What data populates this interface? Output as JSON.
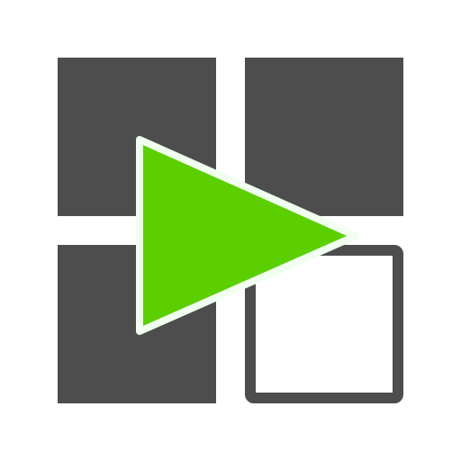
{
  "icon": {
    "name": "grid-play-icon",
    "colors": {
      "tile": "#4d4d4d",
      "empty_tile_fill": "#ffffff",
      "play": "#5ccf00",
      "play_outline": "#f0fff0",
      "background": "#ffffff"
    }
  }
}
